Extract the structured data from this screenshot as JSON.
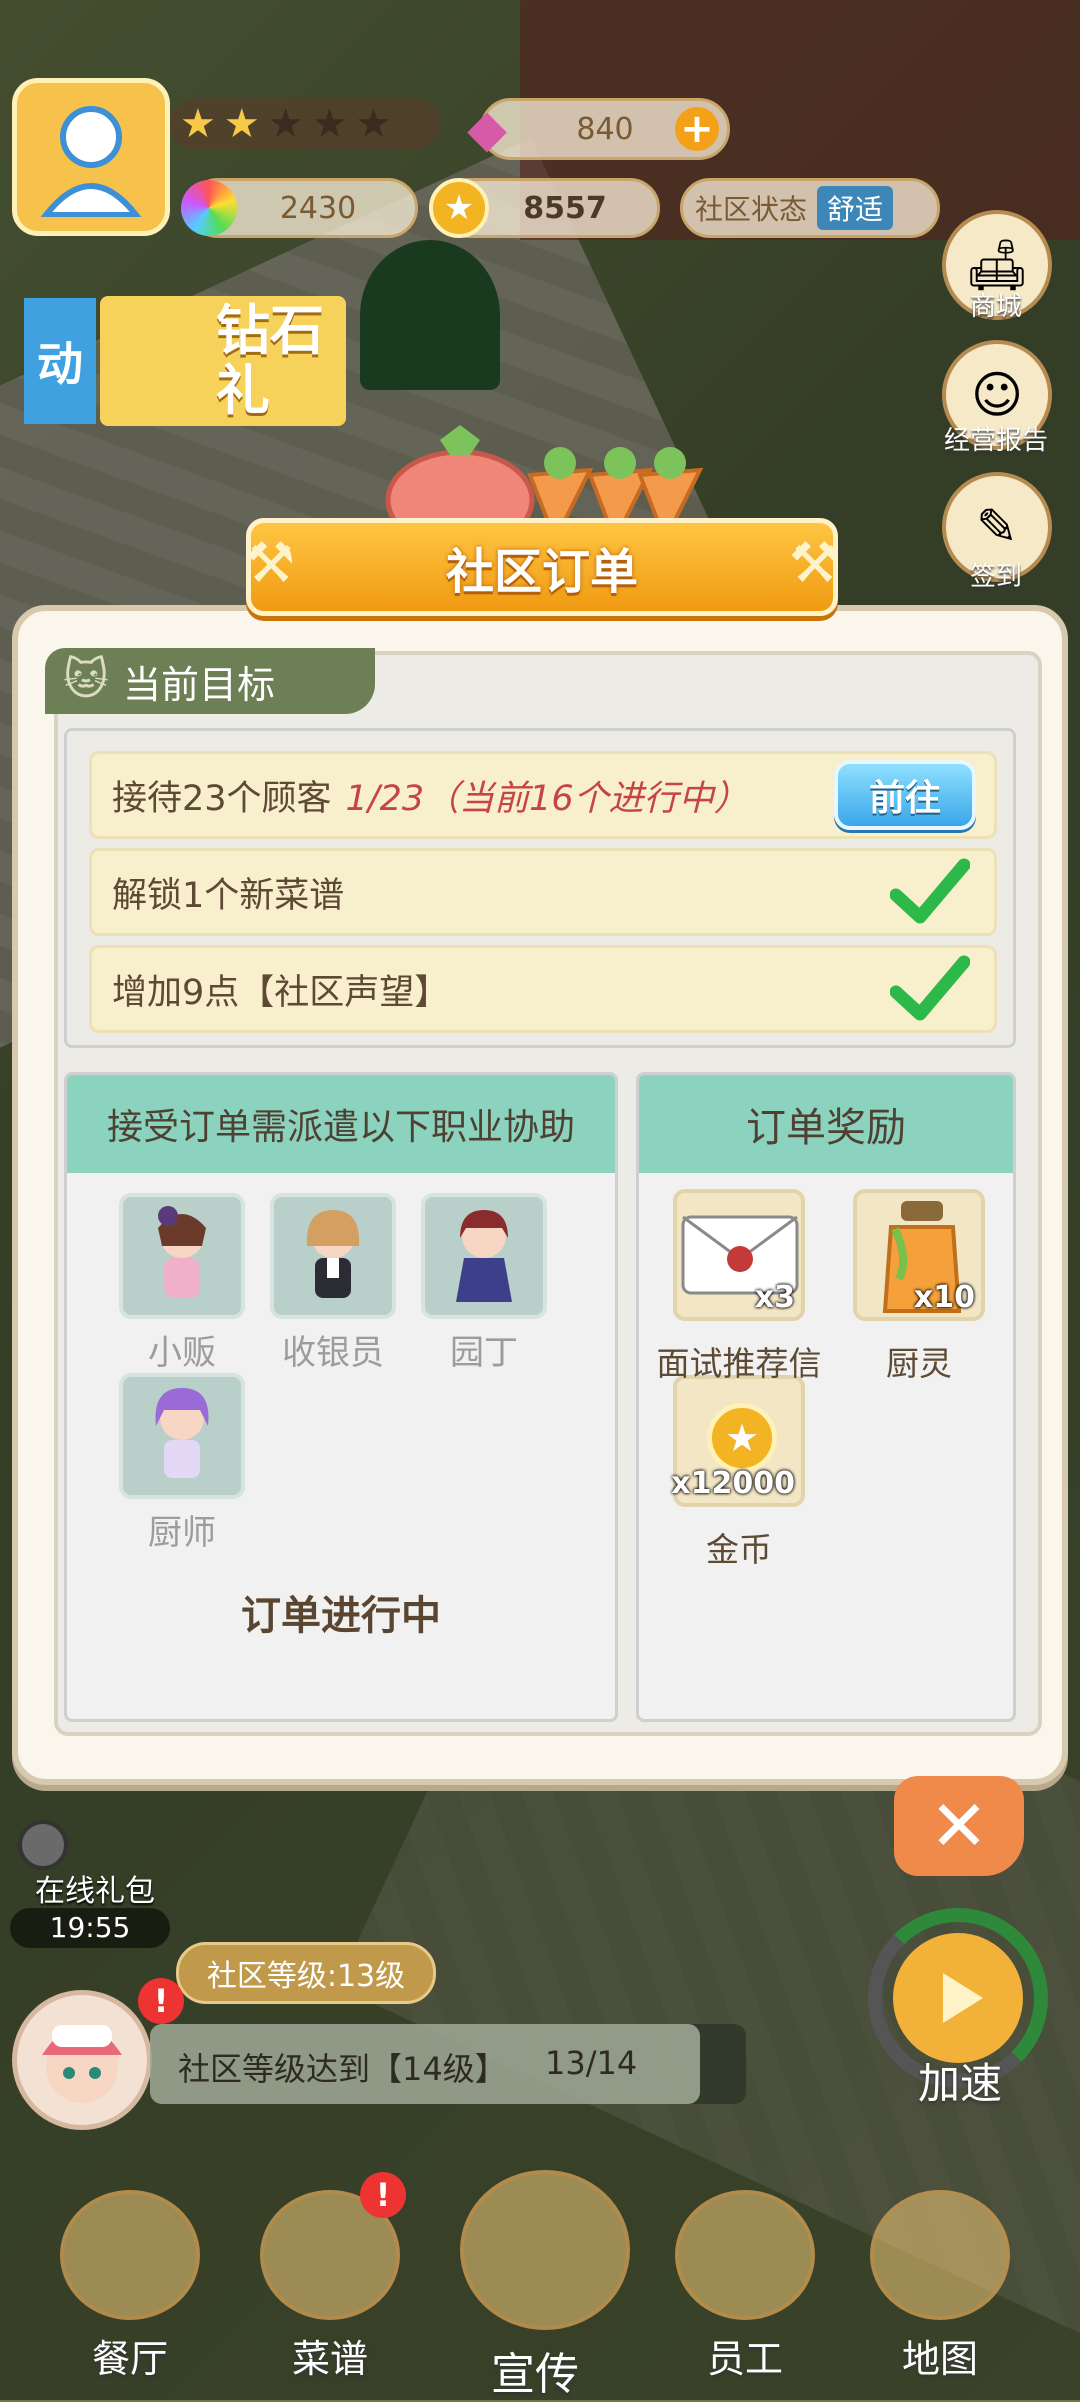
{
  "hud": {
    "diamonds": "840",
    "gems": "2430",
    "coins": "8557",
    "community_status_label": "社区状态",
    "community_status_value": "舒适",
    "stars_filled": 1.5,
    "stars_total": 5
  },
  "side_buttons": [
    {
      "label": "商城",
      "icon": "sofa-icon"
    },
    {
      "label": "经营报告",
      "icon": "smiley-icon"
    },
    {
      "label": "签到",
      "icon": "pencil-icon"
    }
  ],
  "promo": {
    "left_fragment": "动",
    "diamond_banner": "钻石礼"
  },
  "online_gift": {
    "label": "在线礼包",
    "timer": "19:55"
  },
  "community_level": {
    "label": "社区等级:13级",
    "task": "社区等级达到【14级】",
    "progress": "13/14"
  },
  "speed_label": "加速",
  "modal": {
    "title": "社区订单",
    "tab_label": "当前目标",
    "goals": [
      {
        "text": "接待23个顾客",
        "progress": "1/23（当前16个进行中）",
        "action": "前往",
        "done": false
      },
      {
        "text": "解锁1个新菜谱",
        "done": true
      },
      {
        "text": "增加9点【社区声望】",
        "done": true
      }
    ],
    "jobs_panel": {
      "title": "接受订单需派遣以下职业协助",
      "jobs": [
        "小贩",
        "收银员",
        "园丁",
        "厨师"
      ],
      "status": "订单进行中"
    },
    "rewards_panel": {
      "title": "订单奖励",
      "rewards": [
        {
          "name": "面试推荐信",
          "count": "x3",
          "icon": "envelope-icon"
        },
        {
          "name": "厨灵",
          "count": "x10",
          "icon": "jar-icon"
        },
        {
          "name": "金币",
          "count": "x12000",
          "icon": "coin-icon"
        }
      ]
    }
  },
  "nav": [
    {
      "label": "餐厅",
      "icon": "fork-spoon-icon"
    },
    {
      "label": "菜谱",
      "icon": "bowl-icon"
    },
    {
      "label": "宣传",
      "icon": "megaphone-icon"
    },
    {
      "label": "员工",
      "icon": "chef-icon"
    },
    {
      "label": "地图",
      "icon": "egg-map-icon"
    }
  ],
  "colors": {
    "accent_orange": "#f5a623",
    "goal_progress": "#c54545",
    "go_button": "#3aa6e8",
    "panel_header": "#8bd3bf",
    "check_green": "#2db84a"
  }
}
